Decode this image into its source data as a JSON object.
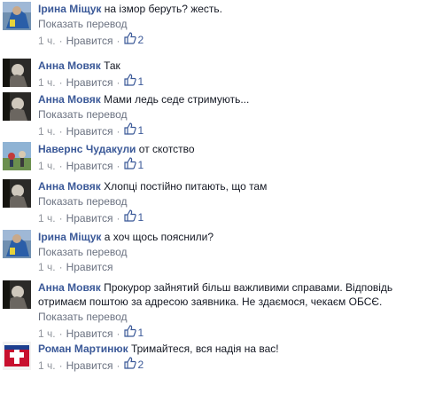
{
  "comments": [
    {
      "author": "Ірина Міщук",
      "text": "на ізмор беруть? жесть.",
      "translate": "Показать перевод",
      "time": "1 ч.",
      "like_label": "Нравится",
      "likes": "2",
      "avatar": "blue-flag"
    },
    {
      "author": "Анна Мовяк",
      "text": "Так",
      "translate": "",
      "time": "1 ч.",
      "like_label": "Нравится",
      "likes": "1",
      "avatar": "dark"
    },
    {
      "author": "Анна Мовяк",
      "text": "Мами ледь седе стримують...",
      "translate": "Показать перевод",
      "time": "1 ч.",
      "like_label": "Нравится",
      "likes": "1",
      "avatar": "dark"
    },
    {
      "author": "Навернс Чудакули",
      "text": "от скотство",
      "translate": "",
      "time": "1 ч.",
      "like_label": "Нравится",
      "likes": "1",
      "avatar": "outdoor"
    },
    {
      "author": "Анна Мовяк",
      "text": "Хлопці постійно питають, що там",
      "translate": "Показать перевод",
      "time": "1 ч.",
      "like_label": "Нравится",
      "likes": "1",
      "avatar": "dark"
    },
    {
      "author": "Ірина Міщук",
      "text": "а хоч щось пояснили?",
      "translate": "Показать перевод",
      "time": "1 ч.",
      "like_label": "Нравится",
      "likes": "",
      "avatar": "blue-flag"
    },
    {
      "author": "Анна Мовяк",
      "text": "Прокурор зайнятий більш важливими справами. Відповідь отримаєм поштою за адресою заявника. Не здаємося, чекаєм ОБСЄ.",
      "translate": "Показать перевод",
      "time": "1 ч.",
      "like_label": "Нравится",
      "likes": "1",
      "avatar": "dark"
    },
    {
      "author": "Роман Мартинюк",
      "text": "Тримайтеся, вся надія на вас!",
      "translate": "",
      "time": "1 ч.",
      "like_label": "Нравится",
      "likes": "2",
      "avatar": "red-cross"
    }
  ],
  "colors": {
    "link": "#3b5998",
    "meta": "#90949c",
    "text": "#141823"
  }
}
